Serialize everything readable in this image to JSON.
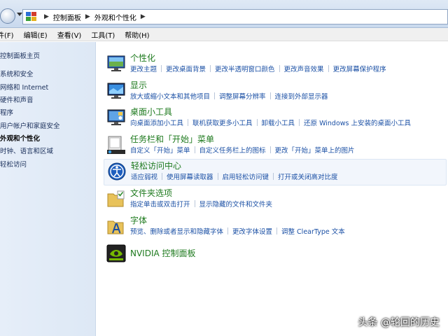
{
  "breadcrumb": [
    "控制面板",
    "外观和个性化"
  ],
  "menu": [
    "件(F)",
    "编辑(E)",
    "查看(V)",
    "工具(T)",
    "帮助(H)"
  ],
  "sidebar": {
    "items": [
      {
        "label": "控制面板主页",
        "active": false
      },
      {
        "label": "系统和安全",
        "active": false
      },
      {
        "label": "网络和 Internet",
        "active": false
      },
      {
        "label": "硬件和声音",
        "active": false
      },
      {
        "label": "程序",
        "active": false
      },
      {
        "label": "用户帐户和家庭安全",
        "active": false
      },
      {
        "label": "外观和个性化",
        "active": true
      },
      {
        "label": "时钟、语言和区域",
        "active": false
      },
      {
        "label": "轻松访问",
        "active": false
      }
    ]
  },
  "categories": [
    {
      "title": "个性化",
      "icon": "personalization-icon",
      "links": [
        "更改主题",
        "更改桌面背景",
        "更改半透明窗口颜色",
        "更改声音效果",
        "更改屏幕保护程序"
      ]
    },
    {
      "title": "显示",
      "icon": "display-icon",
      "links": [
        "放大或缩小文本和其他项目",
        "调整屏幕分辨率",
        "连接到外部显示器"
      ]
    },
    {
      "title": "桌面小工具",
      "icon": "gadgets-icon",
      "links": [
        "向桌面添加小工具",
        "联机获取更多小工具",
        "卸载小工具",
        "还原 Windows 上安装的桌面小工具"
      ]
    },
    {
      "title": "任务栏和「开始」菜单",
      "icon": "taskbar-icon",
      "links": [
        "自定义「开始」菜单",
        "自定义任务栏上的图标",
        "更改「开始」菜单上的图片"
      ]
    },
    {
      "title": "轻松访问中心",
      "icon": "ease-of-access-icon",
      "links": [
        "适应弱视",
        "使用屏幕读取器",
        "启用轻松访问键",
        "打开或关闭高对比度"
      ]
    },
    {
      "title": "文件夹选项",
      "icon": "folder-options-icon",
      "links": [
        "指定单击或双击打开",
        "显示隐藏的文件和文件夹"
      ]
    },
    {
      "title": "字体",
      "icon": "fonts-icon",
      "links": [
        "预览、删除或者显示和隐藏字体",
        "更改字体设置",
        "调整 ClearType 文本"
      ]
    },
    {
      "title": "NVIDIA 控制面板",
      "icon": "nvidia-icon",
      "links": []
    }
  ],
  "watermark": "头条 @轮回的历史",
  "colors": {
    "title_green": "#1e7a1e",
    "link_blue": "#1b50a5",
    "sidebar_bg": "#e6eef9"
  }
}
